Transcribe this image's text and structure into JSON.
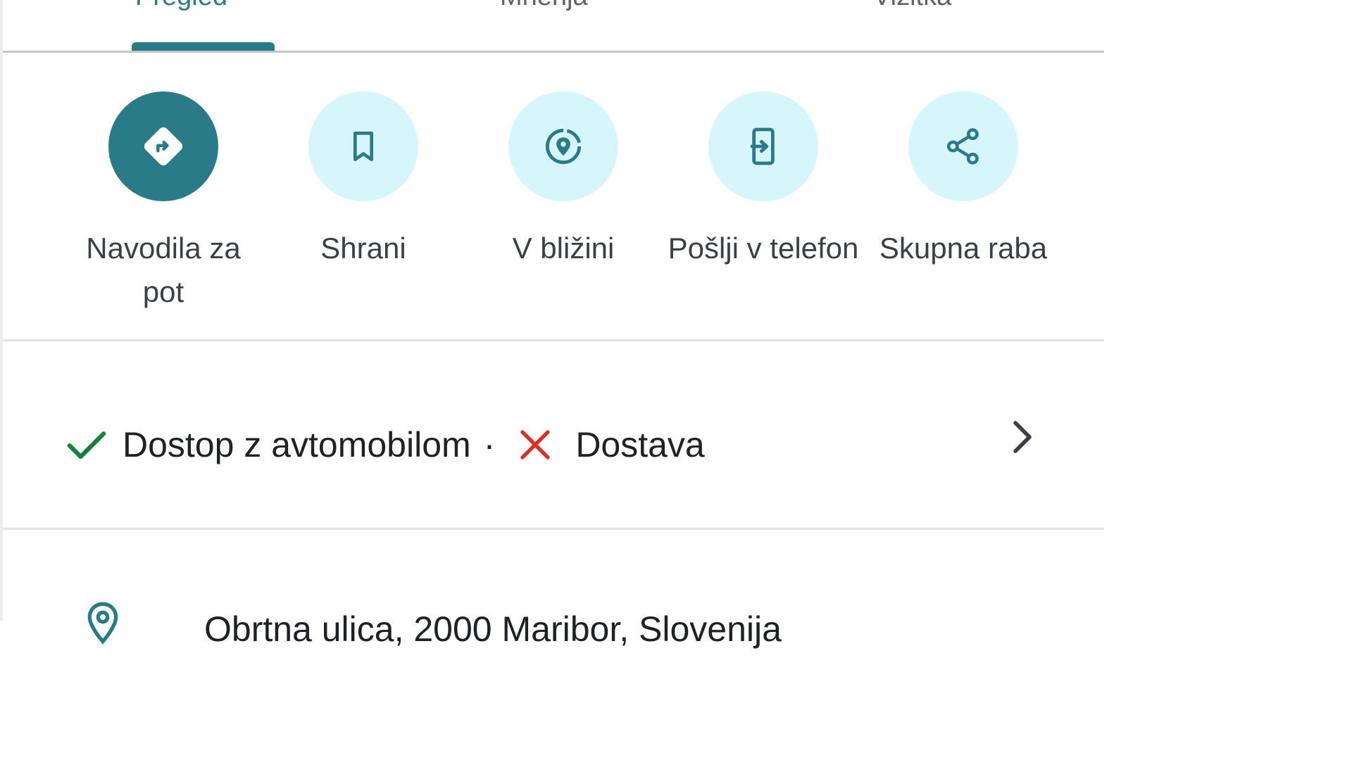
{
  "tabs": [
    {
      "label": "Pregled",
      "active": true
    },
    {
      "label": "Mnenja",
      "active": false
    },
    {
      "label": "Vizitka",
      "active": false
    }
  ],
  "actions": [
    {
      "label": "Navodila za pot",
      "icon": "directions-icon",
      "primary": true
    },
    {
      "label": "Shrani",
      "icon": "bookmark-icon",
      "primary": false
    },
    {
      "label": "V bližini",
      "icon": "nearby-icon",
      "primary": false
    },
    {
      "label": "Pošlji v telefon",
      "icon": "send-to-phone-icon",
      "primary": false
    },
    {
      "label": "Skupna raba",
      "icon": "share-icon",
      "primary": false
    }
  ],
  "amenities": {
    "available_label": "Dostop z avtomobilom",
    "separator": "·",
    "unavailable_label": "Dostava",
    "available_icon": "check-icon",
    "unavailable_icon": "x-icon"
  },
  "address": {
    "text": "Obrtna ulica, 2000 Maribor, Slovenija",
    "icon": "location-pin-icon"
  },
  "colors": {
    "accent": "#2a7b88",
    "button_bg": "#d6f6fc",
    "check": "#188038",
    "cross": "#d93025"
  }
}
